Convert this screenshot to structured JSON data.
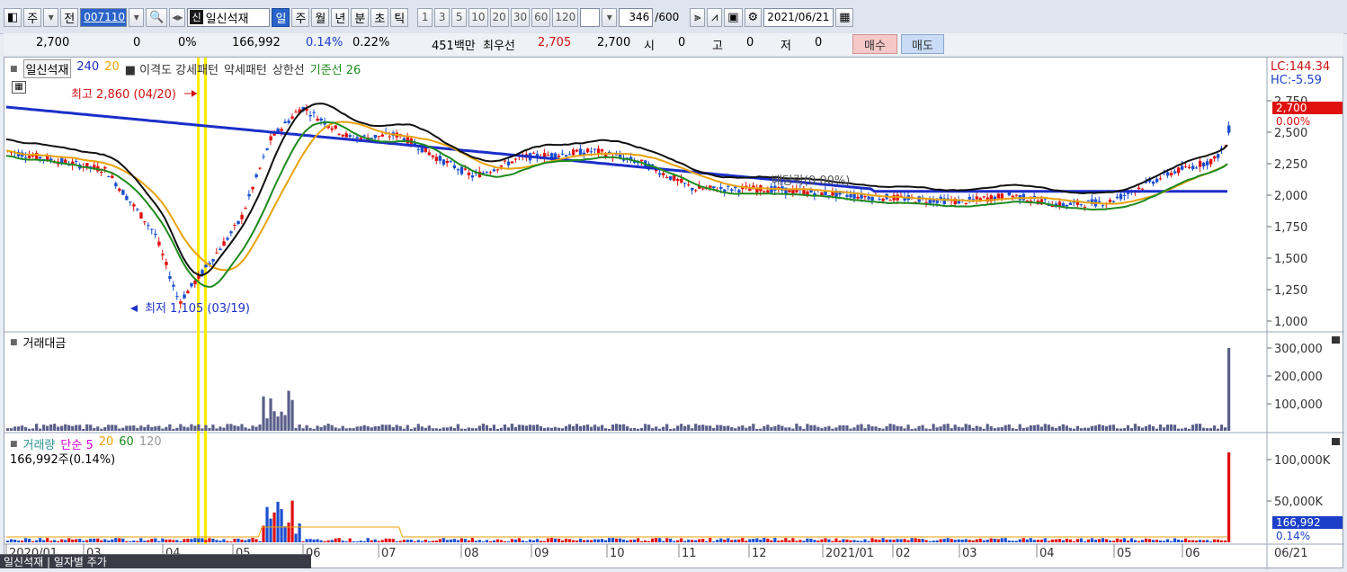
{
  "toolbar": {
    "market_btn": "주",
    "prev_btn": "전",
    "code": "007110",
    "stock_badge": "신",
    "stock_name": "일신석재",
    "periods": [
      "일",
      "주",
      "월",
      "년",
      "분",
      "초",
      "틱"
    ],
    "active_period": "일",
    "intervals": [
      "1",
      "3",
      "5",
      "10",
      "20",
      "30",
      "60",
      "120"
    ],
    "count_value": "346",
    "count_total": "/600",
    "date": "2021/06/21"
  },
  "quote": {
    "price": "2,700",
    "change": "0",
    "change_pct": "0%",
    "volume": "166,992",
    "vol_ratio": "0.14%",
    "turnover": "0.22%",
    "amount": "451백만",
    "best_label": "최우선",
    "best_ask": "2,705",
    "best_bid": "2,700",
    "open_label": "시",
    "open_val": "0",
    "high_label": "고",
    "high_val": "0",
    "low_label": "저",
    "low_val": "0",
    "buy_label": "매수",
    "sell_label": "매도"
  },
  "price_panel": {
    "legend_name": "일신석재",
    "legend_items": [
      {
        "text": "240",
        "color": "#1b2fc9"
      },
      {
        "text": "20",
        "color": "#e8a20a"
      },
      {
        "text": "■ 이격도 강세패턴",
        "color": "#333333"
      },
      {
        "text": "약세패턴",
        "color": "#333333"
      },
      {
        "text": "상한선",
        "color": "#333333"
      },
      {
        "text": "기준선 26",
        "color": "#1e8a1e"
      }
    ],
    "lc_label": "LC:144.34",
    "hc_label": "HC:-5.59",
    "price_tag": "2,700",
    "pct_tag": "0.00%",
    "high_marker": "최고 2,860 (04/20)",
    "low_marker": "최저 1,105 (03/19)",
    "dividend_marker": "배당락(0.00%)",
    "y_ticks": [
      "2,750",
      "2,500",
      "2,250",
      "2,000",
      "1,750",
      "1,500",
      "1,250",
      "1,000"
    ]
  },
  "amount_panel": {
    "title": "거래대금",
    "y_ticks": [
      "300,000",
      "200,000",
      "100,000"
    ]
  },
  "volume_panel": {
    "title": "거래량",
    "legend_items": [
      {
        "text": "단순 5",
        "color": "#d000d0"
      },
      {
        "text": "20",
        "color": "#e8a20a"
      },
      {
        "text": "60",
        "color": "#1e8a1e"
      },
      {
        "text": "120",
        "color": "#999999"
      }
    ],
    "sub": "166,992주(0.14%)",
    "y_ticks": [
      "100,000K",
      "50,000K"
    ],
    "vol_tag": "166,992",
    "vol_pct_tag": "0.14%"
  },
  "x_axis": [
    "2020/01",
    "03",
    "04",
    "05",
    "06",
    "07",
    "08",
    "09",
    "10",
    "11",
    "12",
    "2021/01",
    "02",
    "03",
    "04",
    "05",
    "06"
  ],
  "x_right": "06/21",
  "status_tip": "일신석재 | 일자별 주가"
}
